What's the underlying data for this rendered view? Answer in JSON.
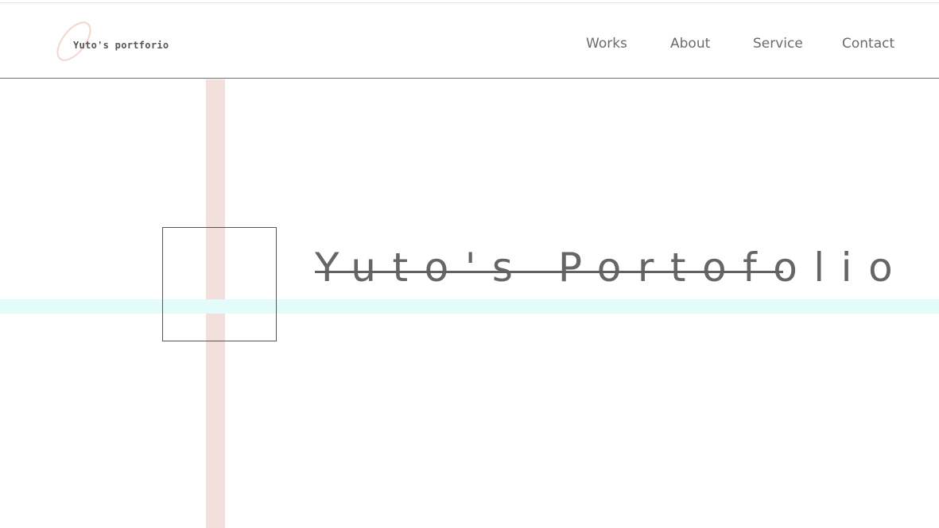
{
  "header": {
    "logo_text": "Yuto's portforio",
    "logo_accent_color": "#f2d9d2",
    "nav": [
      {
        "label": "Works"
      },
      {
        "label": "About"
      },
      {
        "label": "Service"
      },
      {
        "label": "Contact"
      }
    ]
  },
  "hero": {
    "title": "Yuto's Portofolio"
  },
  "colors": {
    "vertical_stripe": "#f3e0dc",
    "horizontal_stripe": "#e3fcf9",
    "text": "#666666"
  }
}
